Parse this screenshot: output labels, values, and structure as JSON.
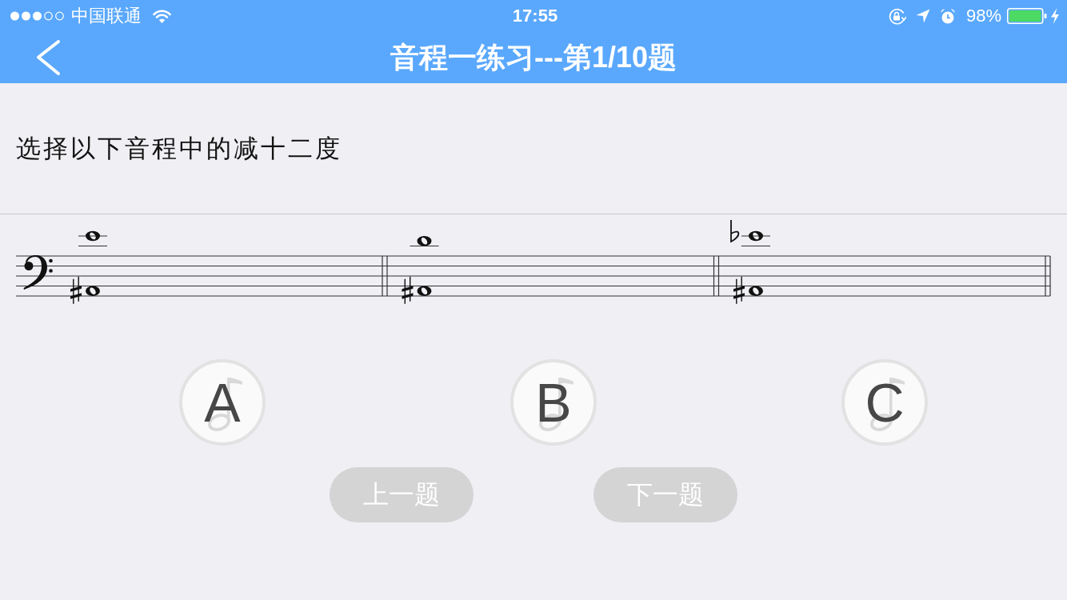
{
  "status_bar": {
    "carrier": "中国联通",
    "time": "17:55",
    "battery": "98%"
  },
  "nav_bar": {
    "title": "音程一练习---第1/10题"
  },
  "question": {
    "prompt": "选择以下音程中的减十二度"
  },
  "options": [
    {
      "label": "A",
      "selected": false
    },
    {
      "label": "B",
      "selected": false
    },
    {
      "label": "C",
      "selected": false
    }
  ],
  "nav_buttons": [
    {
      "label": "上一题",
      "disabled": true
    },
    {
      "label": "下一题",
      "disabled": true
    }
  ]
}
